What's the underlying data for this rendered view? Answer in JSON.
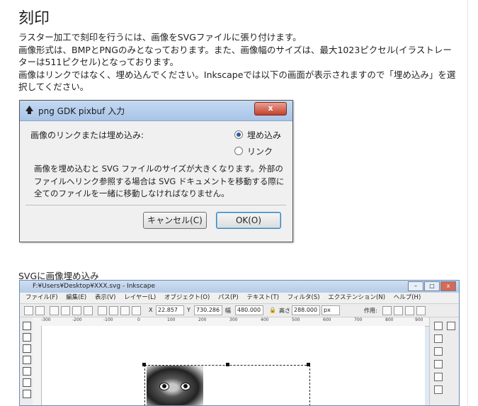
{
  "heading": "刻印",
  "paragraph": {
    "line1": "ラスター加工で刻印を行うには、画像をSVGファイルに張り付けます。",
    "line2": "画像形式は、BMPとPNGのみとなっております。また、画像幅のサイズは、最大1023ピクセル(イラストレーターは511ピクセル)となっております。",
    "line3": "画像はリンクではなく、埋め込んでください。Inkscapeでは以下の画面が表示されますので「埋め込み」を選択してください。"
  },
  "dialog": {
    "title": "png GDK pixbuf 入力",
    "close_label": "x",
    "question": "画像のリンクまたは埋め込み:",
    "options": [
      {
        "label": "埋め込み",
        "selected": true
      },
      {
        "label": "リンク",
        "selected": false
      }
    ],
    "message": "画像を埋め込むと SVG ファイルのサイズが大きくなります。外部のファイルへリンク参照する場合は SVG ドキュメントを移動する際に全てのファイルを一緒に移動しなければなりません。",
    "cancel_label": "キャンセル(C)",
    "ok_label": "OK(O)"
  },
  "section_label": "SVGに画像埋め込み",
  "inkscape": {
    "title": "F:¥Users¥Desktop¥XXX.svg - Inkscape",
    "menu": [
      "ファイル(F)",
      "編集(E)",
      "表示(V)",
      "レイヤー(L)",
      "オブジェクト(O)",
      "パス(P)",
      "テキスト(T)",
      "フィルタ(S)",
      "エクステンション(N)",
      "ヘルプ(H)"
    ],
    "fields": {
      "x_label": "X",
      "x_value": "22.857",
      "y_label": "Y",
      "y_value": "730.286",
      "w_label": "幅",
      "w_value": "480.000",
      "h_label": "高さ",
      "h_value": "288.000",
      "unit": "px",
      "action_label": "作用:"
    },
    "ruler_ticks": [
      "-300",
      "-200",
      "-100",
      "0",
      "100",
      "200",
      "300",
      "400",
      "500",
      "600",
      "700",
      "800",
      "900"
    ],
    "colors": {
      "titlebar": "#b7cbe6",
      "close": "#c4412b"
    }
  }
}
